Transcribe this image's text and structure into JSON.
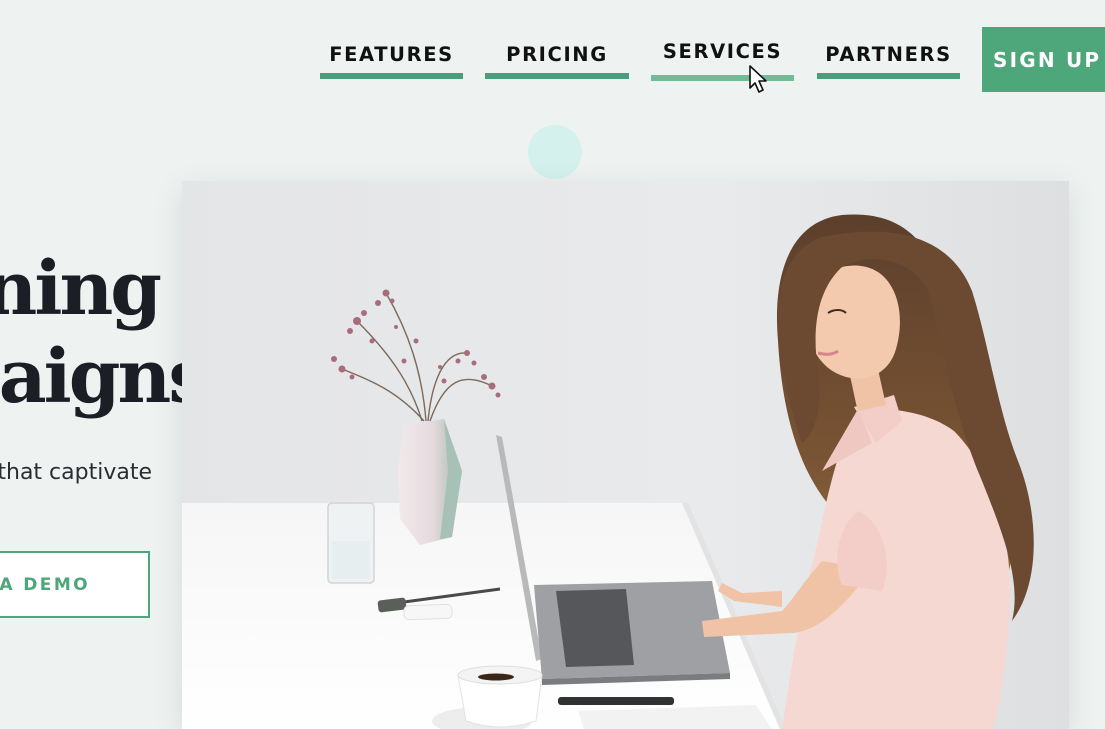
{
  "nav": {
    "items": [
      {
        "label": "FEATURES"
      },
      {
        "label": "PRICING"
      },
      {
        "label": "SERVICES"
      },
      {
        "label": "PARTNERS"
      }
    ],
    "active": "SERVICES",
    "signup_label": "SIGN UP"
  },
  "hero": {
    "title_line1": "ning",
    "title_line2": "paigns",
    "subtitle": "that captivate",
    "demo_label": "A DEMO"
  },
  "colors": {
    "accent": "#4ea67b",
    "underline": "#4b9e79",
    "background": "#eef3f1",
    "text": "#1b1e25"
  },
  "icons": {
    "cursor": "mouse-pointer-icon"
  }
}
